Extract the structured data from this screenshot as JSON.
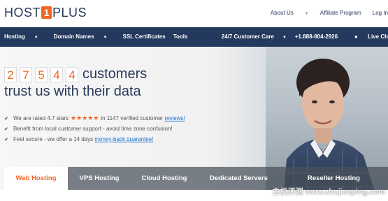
{
  "logo": {
    "part1": "HOST",
    "box": "1",
    "part2": "PLUS"
  },
  "toplinks": {
    "about": "About Us",
    "affiliate": "Affiliate Program",
    "login": "Log In"
  },
  "nav": {
    "hosting": "Hosting",
    "domains": "Domain Names",
    "ssl": "SSL Certificates",
    "tools": "Tools",
    "care": "24/7 Customer Care",
    "phone": "+1.888-804-2926",
    "chat": "Live Ch"
  },
  "hero": {
    "digits": [
      "2",
      "7",
      "5",
      "4",
      "4"
    ],
    "word": "customers",
    "line2": "trust us with their data",
    "bullets": {
      "b1_pre": "We are rated 4.7 stars",
      "b1_mid": "in 1147 verified customer",
      "b1_link": "reviews!",
      "b2": "Benefit from local customer support - avoid time zone confusion!",
      "b3_pre": "Feel secure - we offer a 14 days",
      "b3_link": "money-back guarantee!"
    },
    "rating": 4.7
  },
  "tabs": [
    "Web Hosting",
    "VPS Hosting",
    "Cloud Hosting",
    "Dedicated Servers",
    "Reseller Hosting"
  ],
  "watermark": "主机评测 www.zhujiceping.com",
  "colors": {
    "brand": "#f26522",
    "navy": "#24395e"
  }
}
